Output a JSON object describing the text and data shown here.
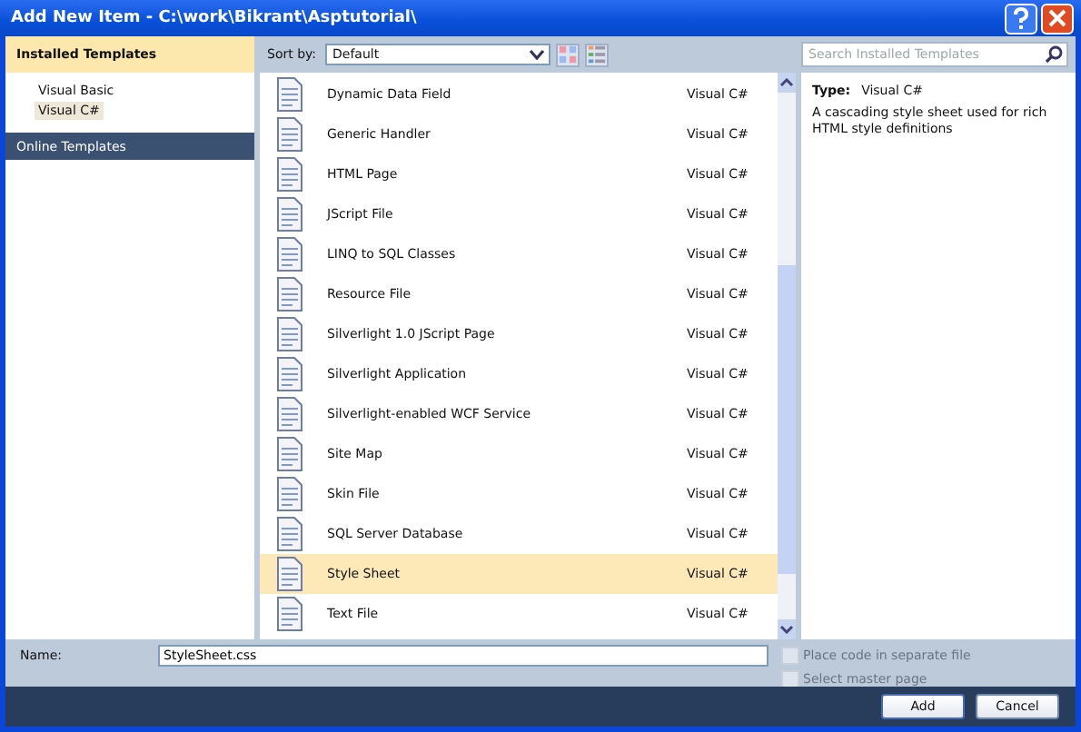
{
  "window": {
    "title": "Add New Item - C:\\work\\Bikrant\\Asptutorial\\"
  },
  "sidebar": {
    "header": "Installed Templates",
    "items": [
      {
        "label": "Visual Basic",
        "selected": false
      },
      {
        "label": "Visual C#",
        "selected": true
      }
    ],
    "online": "Online Templates"
  },
  "toolbar": {
    "sort_label": "Sort by:",
    "sort_value": "Default",
    "search_placeholder": "Search Installed Templates"
  },
  "templates": [
    {
      "name": "Dynamic Data Field",
      "language": "Visual C#",
      "selected": false
    },
    {
      "name": "Generic Handler",
      "language": "Visual C#",
      "selected": false
    },
    {
      "name": "HTML Page",
      "language": "Visual C#",
      "selected": false
    },
    {
      "name": "JScript File",
      "language": "Visual C#",
      "selected": false
    },
    {
      "name": "LINQ to SQL Classes",
      "language": "Visual C#",
      "selected": false
    },
    {
      "name": "Resource File",
      "language": "Visual C#",
      "selected": false
    },
    {
      "name": "Silverlight 1.0 JScript Page",
      "language": "Visual C#",
      "selected": false
    },
    {
      "name": "Silverlight Application",
      "language": "Visual C#",
      "selected": false
    },
    {
      "name": "Silverlight-enabled WCF Service",
      "language": "Visual C#",
      "selected": false
    },
    {
      "name": "Site Map",
      "language": "Visual C#",
      "selected": false
    },
    {
      "name": "Skin File",
      "language": "Visual C#",
      "selected": false
    },
    {
      "name": "SQL Server Database",
      "language": "Visual C#",
      "selected": false
    },
    {
      "name": "Style Sheet",
      "language": "Visual C#",
      "selected": true
    },
    {
      "name": "Text File",
      "language": "Visual C#",
      "selected": false
    }
  ],
  "details": {
    "type_label": "Type:",
    "type_value": "Visual C#",
    "description": "A cascading style sheet used for rich HTML style definitions"
  },
  "name_field": {
    "label": "Name:",
    "value": "StyleSheet.css"
  },
  "options": [
    {
      "label": "Place code in separate file",
      "checked": false,
      "disabled": true
    },
    {
      "label": "Select master page",
      "checked": false,
      "disabled": true
    }
  ],
  "buttons": [
    "Add",
    "Cancel"
  ]
}
